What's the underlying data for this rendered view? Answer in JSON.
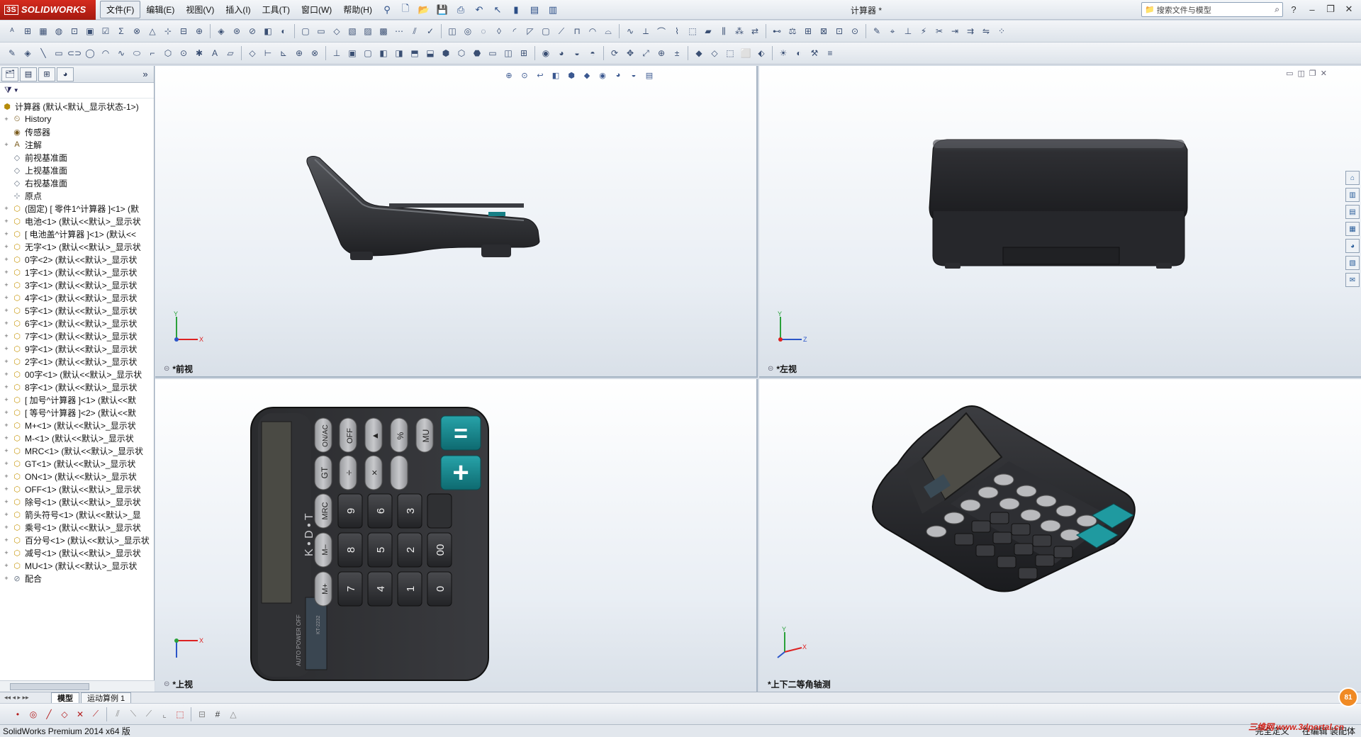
{
  "app": {
    "brand": "SOLIDWORKS",
    "brand_mark": "3S",
    "doc_title": "计算器 *",
    "search_placeholder": "搜索文件与模型"
  },
  "menu": [
    {
      "label": "文件(F)",
      "active": true
    },
    {
      "label": "编辑(E)"
    },
    {
      "label": "视图(V)"
    },
    {
      "label": "插入(I)"
    },
    {
      "label": "工具(T)"
    },
    {
      "label": "窗口(W)"
    },
    {
      "label": "帮助(H)"
    }
  ],
  "tree": {
    "filter_icon": "▼",
    "nodes": [
      {
        "label": "计算器 (默认<默认_显示状态-1>)",
        "icon": "assembly-icon",
        "exp": ""
      },
      {
        "label": "History",
        "icon": "history-icon",
        "exp": "+"
      },
      {
        "label": "传感器",
        "icon": "sensor-icon",
        "exp": ""
      },
      {
        "label": "注解",
        "icon": "annotation-icon",
        "exp": "+"
      },
      {
        "label": "前视基准面",
        "icon": "plane-icon",
        "exp": ""
      },
      {
        "label": "上视基准面",
        "icon": "plane-icon",
        "exp": ""
      },
      {
        "label": "右视基准面",
        "icon": "plane-icon",
        "exp": ""
      },
      {
        "label": "原点",
        "icon": "origin-icon",
        "exp": ""
      },
      {
        "label": "(固定) [ 零件1^计算器 ]<1> (默",
        "icon": "part-icon",
        "exp": "+"
      },
      {
        "label": "电池<1> (默认<<默认>_显示状",
        "icon": "part-icon",
        "exp": "+"
      },
      {
        "label": "[ 电池盖^计算器 ]<1> (默认<<",
        "icon": "part-icon",
        "exp": "+"
      },
      {
        "label": "无字<1> (默认<<默认>_显示状",
        "icon": "part-icon",
        "exp": "+"
      },
      {
        "label": "0字<2> (默认<<默认>_显示状",
        "icon": "part-icon",
        "exp": "+"
      },
      {
        "label": "1字<1> (默认<<默认>_显示状",
        "icon": "part-icon",
        "exp": "+"
      },
      {
        "label": "3字<1> (默认<<默认>_显示状",
        "icon": "part-icon",
        "exp": "+"
      },
      {
        "label": "4字<1> (默认<<默认>_显示状",
        "icon": "part-icon",
        "exp": "+"
      },
      {
        "label": "5字<1> (默认<<默认>_显示状",
        "icon": "part-icon",
        "exp": "+"
      },
      {
        "label": "6字<1> (默认<<默认>_显示状",
        "icon": "part-icon",
        "exp": "+"
      },
      {
        "label": "7字<1> (默认<<默认>_显示状",
        "icon": "part-icon",
        "exp": "+"
      },
      {
        "label": "9字<1> (默认<<默认>_显示状",
        "icon": "part-icon",
        "exp": "+"
      },
      {
        "label": "2字<1> (默认<<默认>_显示状",
        "icon": "part-icon",
        "exp": "+"
      },
      {
        "label": "00字<1> (默认<<默认>_显示状",
        "icon": "part-icon",
        "exp": "+"
      },
      {
        "label": "8字<1> (默认<<默认>_显示状",
        "icon": "part-icon",
        "exp": "+"
      },
      {
        "label": "[ 加号^计算器 ]<1> (默认<<默",
        "icon": "part-icon",
        "exp": "+"
      },
      {
        "label": "[ 等号^计算器 ]<2> (默认<<默",
        "icon": "part-icon",
        "exp": "+"
      },
      {
        "label": "M+<1> (默认<<默认>_显示状",
        "icon": "part-icon",
        "exp": "+"
      },
      {
        "label": "M-<1> (默认<<默认>_显示状",
        "icon": "part-icon",
        "exp": "+"
      },
      {
        "label": "MRC<1> (默认<<默认>_显示状",
        "icon": "part-icon",
        "exp": "+"
      },
      {
        "label": "GT<1> (默认<<默认>_显示状",
        "icon": "part-icon",
        "exp": "+"
      },
      {
        "label": "ON<1> (默认<<默认>_显示状",
        "icon": "part-icon",
        "exp": "+"
      },
      {
        "label": "OFF<1> (默认<<默认>_显示状",
        "icon": "part-icon",
        "exp": "+"
      },
      {
        "label": "除号<1> (默认<<默认>_显示状",
        "icon": "part-icon",
        "exp": "+"
      },
      {
        "label": "箭头符号<1> (默认<<默认>_显",
        "icon": "part-icon",
        "exp": "+"
      },
      {
        "label": "乘号<1> (默认<<默认>_显示状",
        "icon": "part-icon",
        "exp": "+"
      },
      {
        "label": "百分号<1> (默认<<默认>_显示状",
        "icon": "part-icon",
        "exp": "+"
      },
      {
        "label": "减号<1> (默认<<默认>_显示状",
        "icon": "part-icon",
        "exp": "+"
      },
      {
        "label": "MU<1> (默认<<默认>_显示状",
        "icon": "part-icon",
        "exp": "+"
      },
      {
        "label": "配合",
        "icon": "mates-icon",
        "exp": "+"
      }
    ]
  },
  "viewports": {
    "front": "*前视",
    "left": "*左视",
    "top": "*上视",
    "iso": "*上下二等角轴测"
  },
  "triad_axes": {
    "y": "Y",
    "x": "X",
    "z": "Z"
  },
  "calculator": {
    "brand_text": "K • D • T",
    "model_text": "KT-2232",
    "solar_text": "AUTO POWER OFF",
    "keys": {
      "row1": [
        "ON/AC",
        "OFF",
        "▲",
        "%",
        "MU",
        "="
      ],
      "row2": [
        "GT",
        "÷",
        "×",
        "",
        "+"
      ],
      "col_mem": [
        "MRC",
        "M–",
        "M+"
      ],
      "digits_c1": [
        "9",
        "8",
        "7"
      ],
      "digits_c2": [
        "6",
        "5",
        "4"
      ],
      "digits_c3": [
        "3",
        "2",
        "1"
      ],
      "digits_c4": [
        "",
        "00",
        "0"
      ]
    }
  },
  "bottom_tabs": [
    {
      "label": "模型",
      "active": true
    },
    {
      "label": "运动算例 1"
    }
  ],
  "status": {
    "left": "SolidWorks Premium 2014 x64 版",
    "right": [
      "完全定义",
      "在编辑 装配体"
    ]
  },
  "watermark": "三维网 www.3dportal.cn",
  "notif_badge": "81",
  "colors": {
    "accent_teal": "#167f86",
    "body_dark": "#2d2d30",
    "solidworks_red": "#c8261b"
  }
}
